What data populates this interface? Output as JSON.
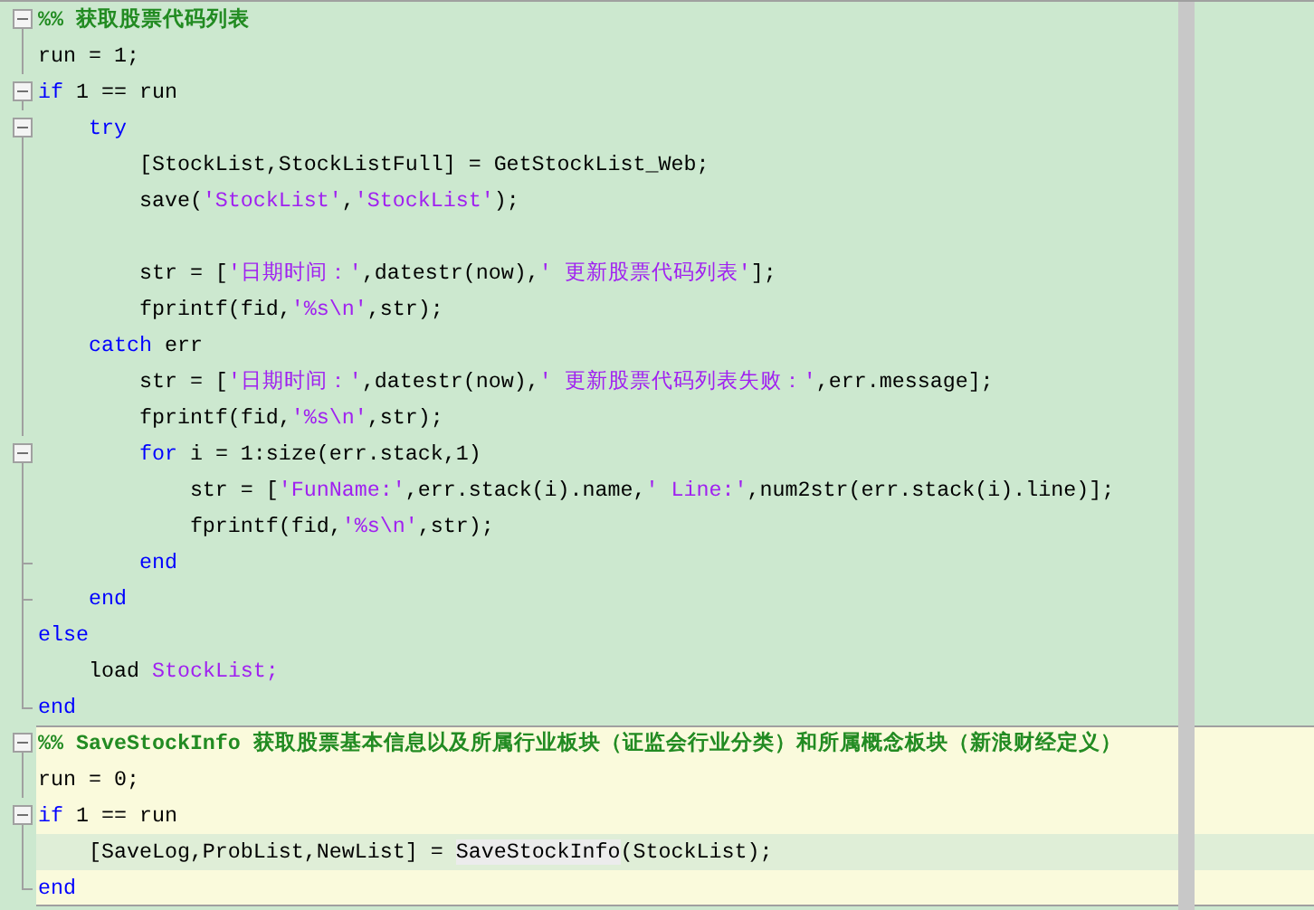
{
  "cells": [
    {
      "current": false,
      "lines": [
        {
          "kind": "box",
          "current": false,
          "tokens": [
            {
              "kind": "comment",
              "text": "%% 获取股票代码列表"
            }
          ]
        },
        {
          "kind": "line",
          "current": false,
          "tokens": [
            {
              "kind": "plain",
              "text": "run = 1;"
            }
          ]
        },
        {
          "kind": "box",
          "current": false,
          "tokens": [
            {
              "kind": "keyword",
              "text": "if"
            },
            {
              "kind": "plain",
              "text": " 1 == run"
            }
          ]
        },
        {
          "kind": "box",
          "current": false,
          "tokens": [
            {
              "kind": "keyword",
              "text": "    try"
            }
          ]
        },
        {
          "kind": "line",
          "current": false,
          "tokens": [
            {
              "kind": "plain",
              "text": "        [StockList,StockListFull] = GetStockList_Web;"
            }
          ]
        },
        {
          "kind": "line",
          "current": false,
          "tokens": [
            {
              "kind": "plain",
              "text": "        save("
            },
            {
              "kind": "string",
              "text": "'StockList'"
            },
            {
              "kind": "plain",
              "text": ","
            },
            {
              "kind": "string",
              "text": "'StockList'"
            },
            {
              "kind": "plain",
              "text": ");"
            }
          ]
        },
        {
          "kind": "line",
          "current": false
        },
        {
          "kind": "line",
          "current": false,
          "tokens": [
            {
              "kind": "plain",
              "text": "        str = ["
            },
            {
              "kind": "string",
              "text": "'日期时间：'"
            },
            {
              "kind": "plain",
              "text": ",datestr(now),"
            },
            {
              "kind": "string",
              "text": "' 更新股票代码列表'"
            },
            {
              "kind": "plain",
              "text": "];"
            }
          ]
        },
        {
          "kind": "line",
          "current": false,
          "tokens": [
            {
              "kind": "plain",
              "text": "        fprintf(fid,"
            },
            {
              "kind": "string",
              "text": "'%s\\n'"
            },
            {
              "kind": "plain",
              "text": ",str);"
            }
          ]
        },
        {
          "kind": "line",
          "current": false,
          "tokens": [
            {
              "kind": "keyword",
              "text": "    catch"
            },
            {
              "kind": "plain",
              "text": " err"
            }
          ]
        },
        {
          "kind": "line",
          "current": false,
          "tokens": [
            {
              "kind": "plain",
              "text": "        str = ["
            },
            {
              "kind": "string",
              "text": "'日期时间：'"
            },
            {
              "kind": "plain",
              "text": ",datestr(now),"
            },
            {
              "kind": "string",
              "text": "' 更新股票代码列表失败：'"
            },
            {
              "kind": "plain",
              "text": ",err.message];"
            }
          ]
        },
        {
          "kind": "line",
          "current": false,
          "tokens": [
            {
              "kind": "plain",
              "text": "        fprintf(fid,"
            },
            {
              "kind": "string",
              "text": "'%s\\n'"
            },
            {
              "kind": "plain",
              "text": ",str);"
            }
          ]
        },
        {
          "kind": "box",
          "current": false,
          "tokens": [
            {
              "kind": "keyword",
              "text": "        for"
            },
            {
              "kind": "plain",
              "text": " i = 1:size(err.stack,1)"
            }
          ]
        },
        {
          "kind": "line",
          "current": false,
          "tokens": [
            {
              "kind": "plain",
              "text": "            str = ["
            },
            {
              "kind": "string",
              "text": "'FunName:'"
            },
            {
              "kind": "plain",
              "text": ",err.stack(i).name,"
            },
            {
              "kind": "string",
              "text": "' Line:'"
            },
            {
              "kind": "plain",
              "text": ",num2str(err.stack(i).line)];"
            }
          ]
        },
        {
          "kind": "line",
          "current": false,
          "tokens": [
            {
              "kind": "plain",
              "text": "            fprintf(fid,"
            },
            {
              "kind": "string",
              "text": "'%s\\n'"
            },
            {
              "kind": "plain",
              "text": ",str);"
            }
          ]
        },
        {
          "kind": "tick",
          "current": false,
          "tokens": [
            {
              "kind": "keyword",
              "text": "        end"
            }
          ]
        },
        {
          "kind": "tick",
          "current": false,
          "tokens": [
            {
              "kind": "keyword",
              "text": "    end"
            }
          ]
        },
        {
          "kind": "line",
          "current": false,
          "tokens": [
            {
              "kind": "keyword",
              "text": "else"
            }
          ]
        },
        {
          "kind": "line",
          "current": false,
          "tokens": [
            {
              "kind": "plain",
              "text": "    load "
            },
            {
              "kind": "string",
              "text": "StockList;"
            }
          ]
        },
        {
          "kind": "end",
          "current": false,
          "tokens": [
            {
              "kind": "keyword",
              "text": "end"
            }
          ]
        }
      ]
    },
    {
      "current": true,
      "lines": [
        {
          "kind": "box",
          "current": false,
          "tokens": [
            {
              "kind": "comment",
              "text": "%% SaveStockInfo 获取股票基本信息以及所属行业板块（证监会行业分类）和所属概念板块（新浪财经定义）"
            }
          ]
        },
        {
          "kind": "line",
          "current": false,
          "tokens": [
            {
              "kind": "plain",
              "text": "run = 0;"
            }
          ]
        },
        {
          "kind": "box",
          "current": false,
          "tokens": [
            {
              "kind": "keyword",
              "text": "if"
            },
            {
              "kind": "plain",
              "text": " 1 == run"
            }
          ]
        },
        {
          "kind": "line",
          "current": true,
          "tokens": [
            {
              "kind": "plain",
              "text": "    [SaveLog,ProbList,NewList] = "
            },
            {
              "kind": "marked",
              "text": "SaveStockInfo"
            },
            {
              "kind": "plain",
              "text": "(StockList);"
            }
          ]
        },
        {
          "kind": "end",
          "current": false,
          "tokens": [
            {
              "kind": "keyword",
              "text": "end"
            }
          ]
        }
      ]
    }
  ]
}
